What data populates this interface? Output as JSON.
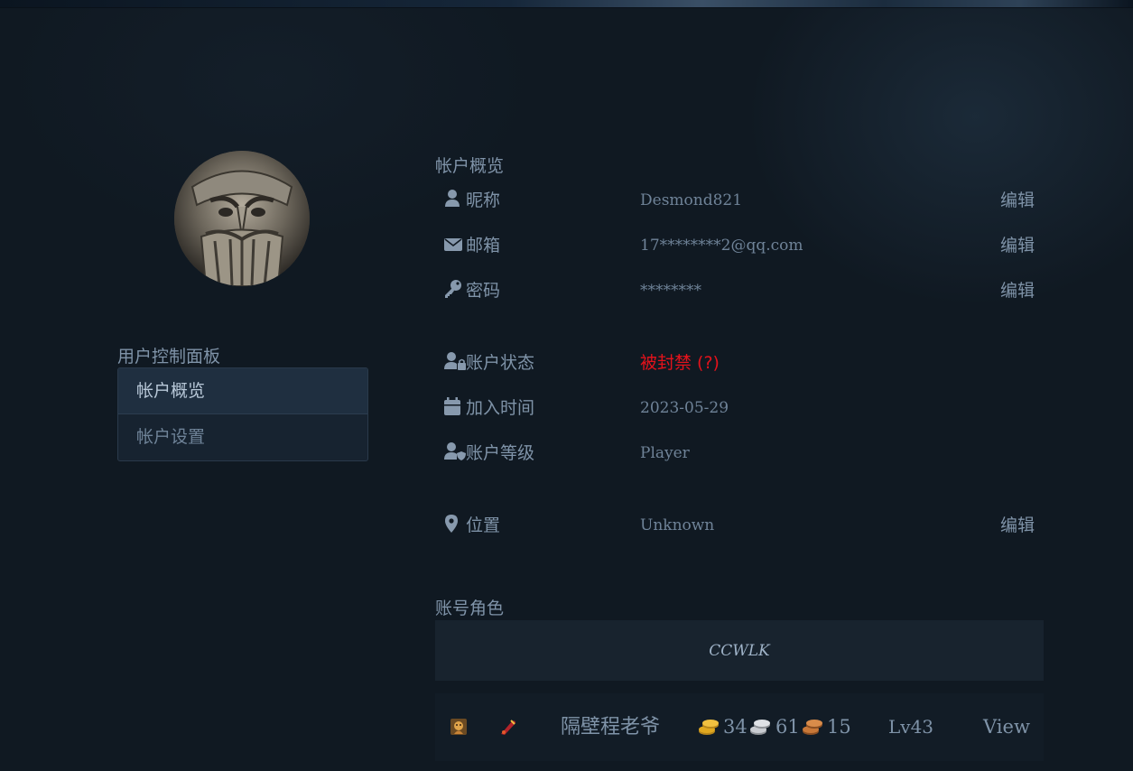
{
  "sidebar": {
    "title": "用户控制面板",
    "items": [
      {
        "label": "帐户概览",
        "active": true
      },
      {
        "label": "帐户设置",
        "active": false
      }
    ]
  },
  "overview": {
    "title": "帐户概览",
    "rows": [
      {
        "icon": "user-icon",
        "label": "昵称",
        "value": "Desmond821",
        "edit": "编辑"
      },
      {
        "icon": "envelope-icon",
        "label": "邮箱",
        "value": "17********2@qq.com",
        "edit": "编辑"
      },
      {
        "icon": "key-icon",
        "label": "密码",
        "value": "********",
        "edit": "编辑"
      },
      {
        "icon": "user-lock-icon",
        "label": "账户状态",
        "value": "被封禁 (?)",
        "value_color": "#e4121b"
      },
      {
        "icon": "calendar-icon",
        "label": "加入时间",
        "value": "2023-05-29"
      },
      {
        "icon": "user-shield-icon",
        "label": "账户等级",
        "value": "Player"
      },
      {
        "icon": "map-pin-icon",
        "label": "位置",
        "value": "Unknown",
        "edit": "编辑"
      }
    ]
  },
  "characters": {
    "title": "账号角色",
    "realm": "CCWLK",
    "list": [
      {
        "race_icon": "race-portrait-icon",
        "class_icon": "class-emblem-icon",
        "name": "隔壁程老爷",
        "gold": "34",
        "silver": "61",
        "copper": "15",
        "level": "Lv43",
        "view": "View"
      }
    ]
  },
  "colors": {
    "background": "#101922",
    "text": "#7f93a8",
    "banned": "#e4121b",
    "gold": "#e0a820",
    "silver": "#c9ccd1",
    "copper": "#c87838"
  }
}
